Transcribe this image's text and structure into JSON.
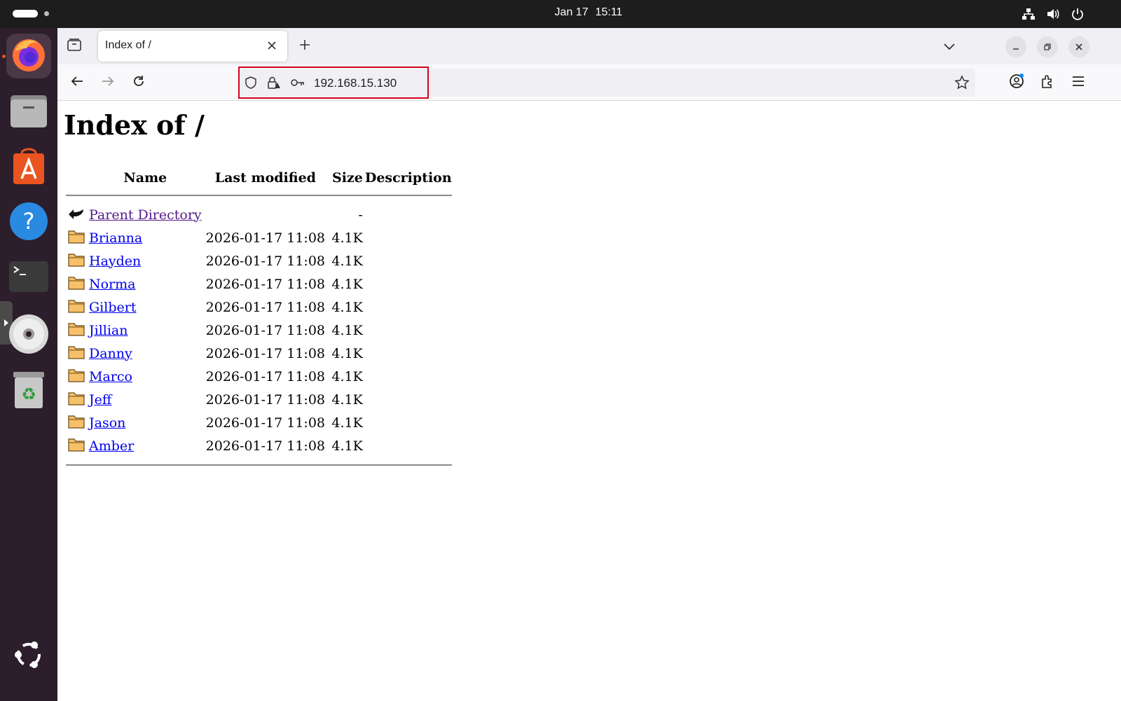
{
  "topbar": {
    "date": "Jan 17",
    "time": "15:11"
  },
  "dock": {
    "items": [
      {
        "name": "Firefox",
        "icon": "firefox-icon",
        "active": true
      },
      {
        "name": "Files",
        "icon": "files-icon"
      },
      {
        "name": "App Center",
        "icon": "app-center-icon"
      },
      {
        "name": "Help",
        "icon": "help-icon"
      },
      {
        "name": "Terminal",
        "icon": "terminal-icon"
      },
      {
        "name": "Disc",
        "icon": "disc-icon"
      },
      {
        "name": "Trash",
        "icon": "trash-icon"
      },
      {
        "name": "Show Apps",
        "icon": "ubuntu-apps-icon"
      }
    ]
  },
  "browser": {
    "tab_title": "Index of /",
    "url": "192.168.15.130"
  },
  "page": {
    "title": "Index of /",
    "headers": {
      "name": "Name",
      "last_modified": "Last modified",
      "size": "Size",
      "description": "Description"
    },
    "parent": {
      "label": "Parent Directory",
      "size": "-"
    },
    "rows": [
      {
        "name": "Brianna",
        "modified": "2026-01-17 11:08",
        "size": "4.1K"
      },
      {
        "name": "Hayden",
        "modified": "2026-01-17 11:08",
        "size": "4.1K"
      },
      {
        "name": "Norma",
        "modified": "2026-01-17 11:08",
        "size": "4.1K"
      },
      {
        "name": "Gilbert",
        "modified": "2026-01-17 11:08",
        "size": "4.1K"
      },
      {
        "name": "Jillian",
        "modified": "2026-01-17 11:08",
        "size": "4.1K"
      },
      {
        "name": "Danny",
        "modified": "2026-01-17 11:08",
        "size": "4.1K"
      },
      {
        "name": "Marco",
        "modified": "2026-01-17 11:08",
        "size": "4.1K"
      },
      {
        "name": "Jeff",
        "modified": "2026-01-17 11:08",
        "size": "4.1K"
      },
      {
        "name": "Jason",
        "modified": "2026-01-17 11:08",
        "size": "4.1K"
      },
      {
        "name": "Amber",
        "modified": "2026-01-17 11:08",
        "size": "4.1K"
      }
    ]
  },
  "colors": {
    "topbar": "#1d1d1d",
    "dock": "#2c1e2b",
    "link": "#0000ee",
    "visited_link": "#551a8b",
    "url_highlight": "#d0021b"
  }
}
